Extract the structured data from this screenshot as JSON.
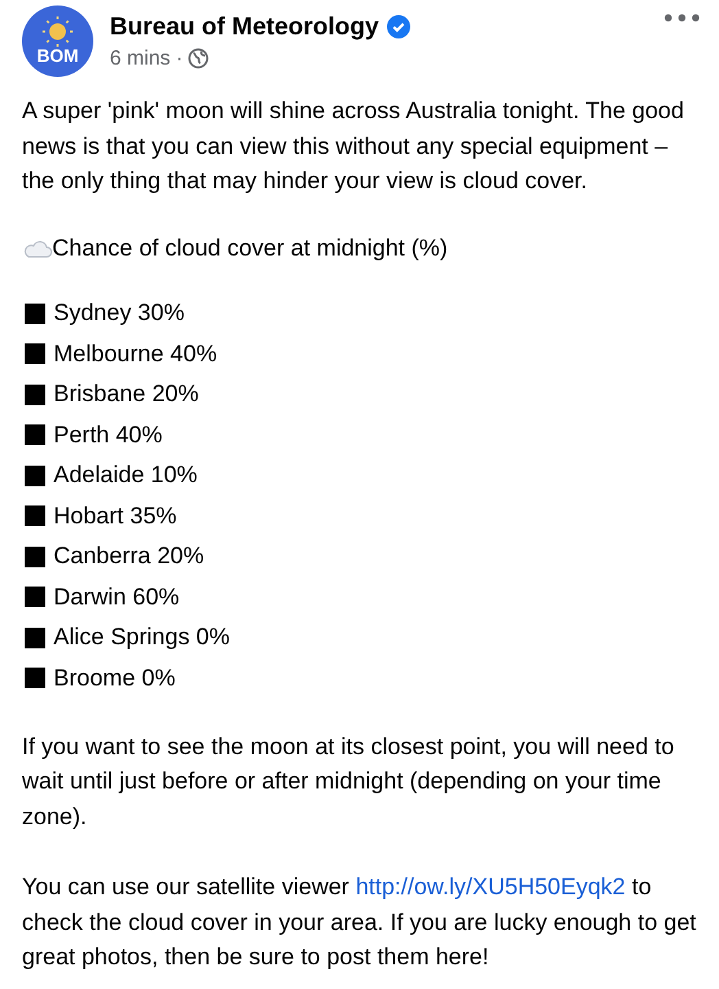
{
  "post": {
    "author": "Bureau of Meteorology",
    "avatar_text": "BOM",
    "verified": true,
    "time": "6 mins",
    "separator": "·"
  },
  "intro": "A super 'pink' moon will shine across Australia tonight. The good news is that you can view this without any special equipment – the only thing that may hinder your view is cloud cover.",
  "heading": "Chance of cloud cover at midnight (%)",
  "cities": [
    "Sydney 30%",
    "Melbourne 40%",
    "Brisbane 20%",
    "Perth 40%",
    "Adelaide 10%",
    "Hobart 35%",
    "Canberra 20%",
    "Darwin 60%",
    "Alice Springs 0%",
    "Broome 0%"
  ],
  "closest": "If you want to see the moon at its closest point, you will need to wait until just before or after midnight (depending on your time zone).",
  "satellite": {
    "before": "You can use our satellite viewer",
    "link": "http://ow.ly/XU5H50Eyqk2",
    "after": "to check the cloud cover in your area.   If you are lucky enough to get great photos, then be sure to post them here!"
  }
}
